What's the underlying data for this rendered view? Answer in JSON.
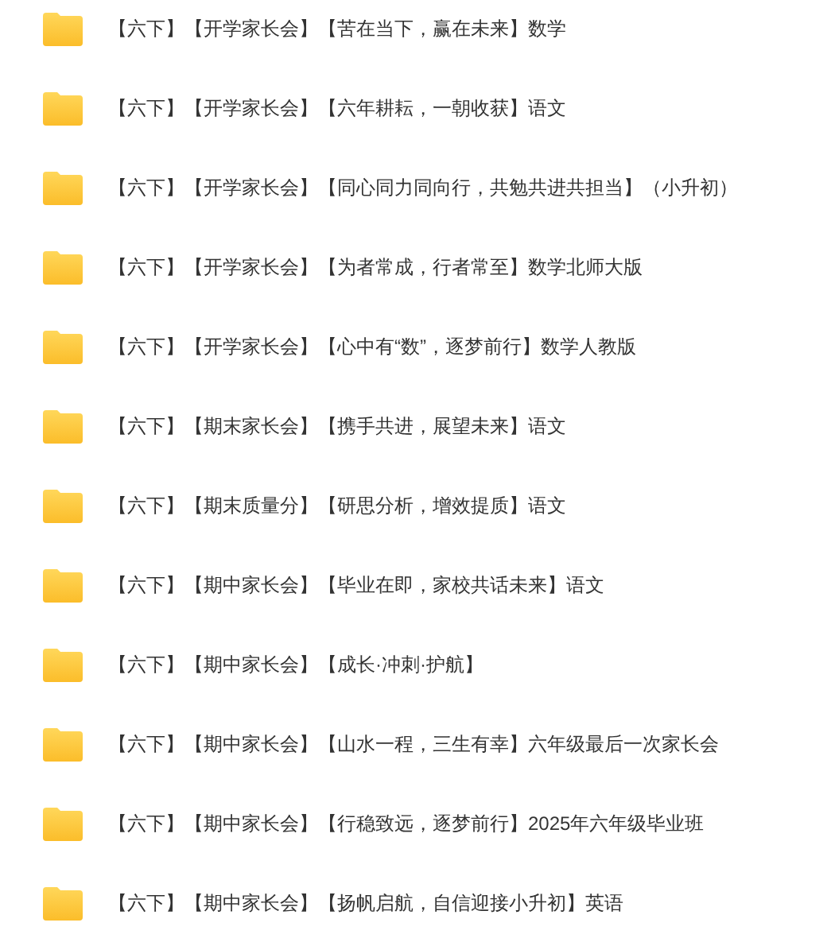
{
  "folders": [
    {
      "name": "【六下】【开学家长会】【苦在当下，赢在未来】数学"
    },
    {
      "name": "【六下】【开学家长会】【六年耕耘，一朝收获】语文"
    },
    {
      "name": "【六下】【开学家长会】【同心同力同向行，共勉共进共担当】（小升初）"
    },
    {
      "name": "【六下】【开学家长会】【为者常成，行者常至】数学北师大版"
    },
    {
      "name": "【六下】【开学家长会】【心中有“数”，逐梦前行】数学人教版"
    },
    {
      "name": "【六下】【期末家长会】【携手共进，展望未来】语文"
    },
    {
      "name": "【六下】【期末质量分】【研思分析，增效提质】语文"
    },
    {
      "name": "【六下】【期中家长会】【毕业在即，家校共话未来】语文"
    },
    {
      "name": "【六下】【期中家长会】【成长·冲刺·护航】"
    },
    {
      "name": "【六下】【期中家长会】【山水一程，三生有幸】六年级最后一次家长会"
    },
    {
      "name": "【六下】【期中家长会】【行稳致远，逐梦前行】2025年六年级毕业班"
    },
    {
      "name": "【六下】【期中家长会】【扬帆启航，自信迎接小升初】英语"
    }
  ]
}
